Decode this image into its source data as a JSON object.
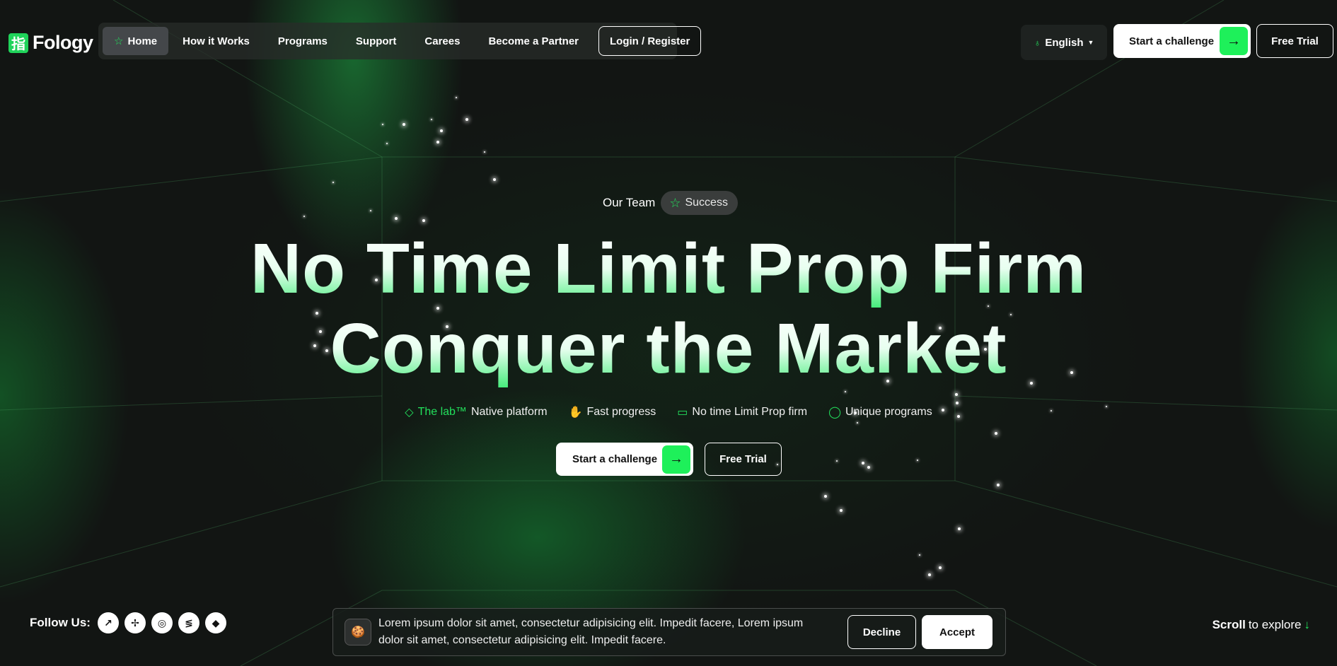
{
  "brand": {
    "logo_glyph": "指",
    "name": "Fology",
    "accent": "#22e05c"
  },
  "nav": {
    "items": [
      {
        "label": "Home",
        "icon": "star-icon",
        "active": true
      },
      {
        "label": "How it Works"
      },
      {
        "label": "Programs"
      },
      {
        "label": "Support"
      },
      {
        "label": "Carees"
      },
      {
        "label": "Become a Partner"
      }
    ],
    "login_label": "Login / Register"
  },
  "header_actions": {
    "language": "English",
    "start_label": "Start a challenge",
    "trial_label": "Free Trial"
  },
  "hero": {
    "eyebrow": "Our Team",
    "pill": "Success",
    "headline_line1": "No Time Limit Prop Firm",
    "headline_line2": "Conquer the Market",
    "features": [
      {
        "icon": "diamond-icon",
        "highlight": "The lab™",
        "text": "Native platform"
      },
      {
        "icon": "hand-icon",
        "text": "Fast progress"
      },
      {
        "icon": "chat-icon",
        "text": "No time Limit Prop firm"
      },
      {
        "icon": "circle-icon",
        "text": "Unique programs"
      }
    ],
    "cta_start": "Start a challenge",
    "cta_trial": "Free Trial"
  },
  "footer": {
    "follow_label": "Follow Us:",
    "socials": [
      "social-icon-1",
      "social-icon-2",
      "social-icon-3",
      "social-icon-4",
      "social-icon-5"
    ],
    "cookie_text": "Lorem ipsum dolor sit amet, consectetur adipisicing elit. Impedit facere, Lorem ipsum dolor sit amet, consectetur adipisicing elit. Impedit facere.",
    "decline_label": "Decline",
    "accept_label": "Accept",
    "scroll_bold": "Scroll",
    "scroll_rest": "to explore"
  }
}
